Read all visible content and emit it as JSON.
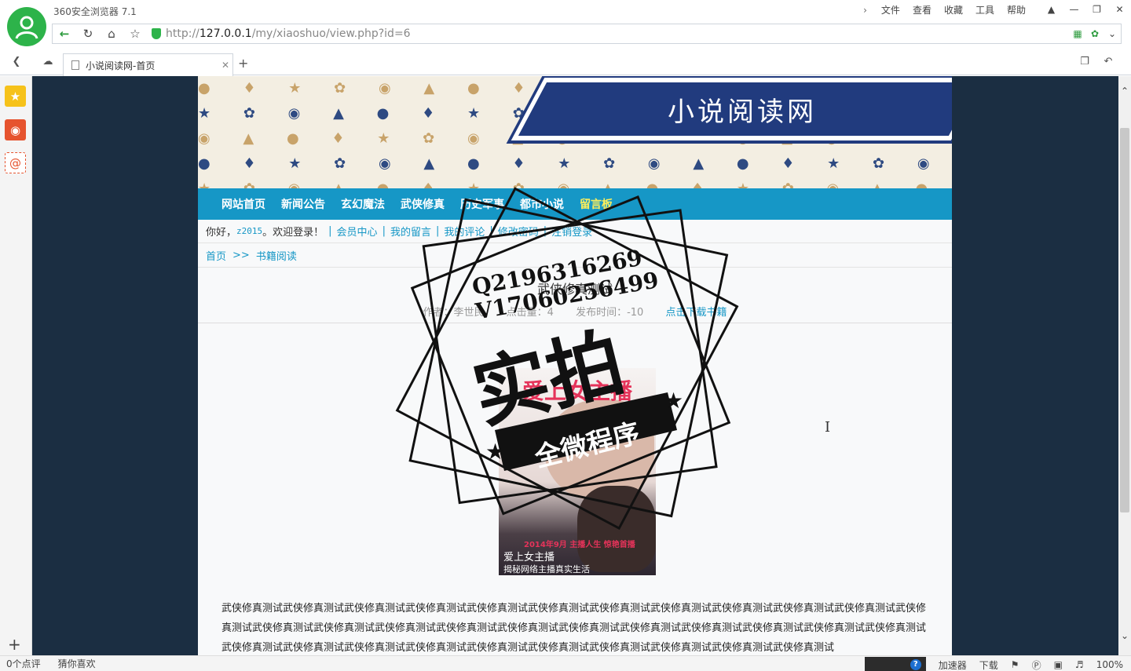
{
  "browser": {
    "app_title": "360安全浏览器 7.1",
    "menu": [
      "文件",
      "查看",
      "收藏",
      "工具",
      "帮助"
    ],
    "url_prefix": "http://",
    "url_host": "127.0.0.1",
    "url_path": "/my/xiaoshuo/view.php?id=6",
    "tab_title": "小说阅读网-首页",
    "accent_color": "#2db34a"
  },
  "site": {
    "brand": "小说阅读网",
    "nav": [
      "网站首页",
      "新闻公告",
      "玄幻魔法",
      "武侠修真",
      "历史军事",
      "都市小说",
      "留言板"
    ],
    "user_greeting": "你好，",
    "username": "z2015",
    "welcome": "。欢迎登录！",
    "user_links": [
      "会员中心",
      "我的留言",
      "我的评论",
      "修改密码",
      "注销登录"
    ],
    "breadcrumb": [
      "首页",
      ">>",
      "书籍阅读"
    ],
    "nav_color": "#1697c6"
  },
  "book": {
    "title": "武侠修真测试",
    "author": "作者：李世民",
    "clicks": "点击量：4",
    "publish": "发布时间：",
    "publish_date": "-10",
    "download": "点击下载书籍",
    "cover_title": "爱上女主播",
    "cover_date": "2014年9月 主播人生 惊艳首播",
    "cover_name": "爱上女主播",
    "cover_tag": "揭秘网络主播真实生活",
    "content": "武侠修真测试武侠修真测试武侠修真测试武侠修真测试武侠修真测试武侠修真测试武侠修真测试武侠修真测试武侠修真测试武侠修真测试武侠修真测试武侠修真测试武侠修真测试武侠修真测试武侠修真测试武侠修真测试武侠修真测试武侠修真测试武侠修真测试武侠修真测试武侠修真测试武侠修真测试武侠修真测试武侠修真测试武侠修真测试武侠修真测试武侠修真测试武侠修真测试武侠修真测试武侠修真测试武侠修真测试武侠修真测试武侠修真测试"
  },
  "watermark": {
    "qq": "Q2196316269",
    "vx": "V17060256499",
    "main": "实拍",
    "sub": "全微程序"
  },
  "statusbar": {
    "comments": "0个点评",
    "guess": "猜你喜欢",
    "accelerator": "加速器",
    "download": "下载",
    "zoom": "100%"
  }
}
